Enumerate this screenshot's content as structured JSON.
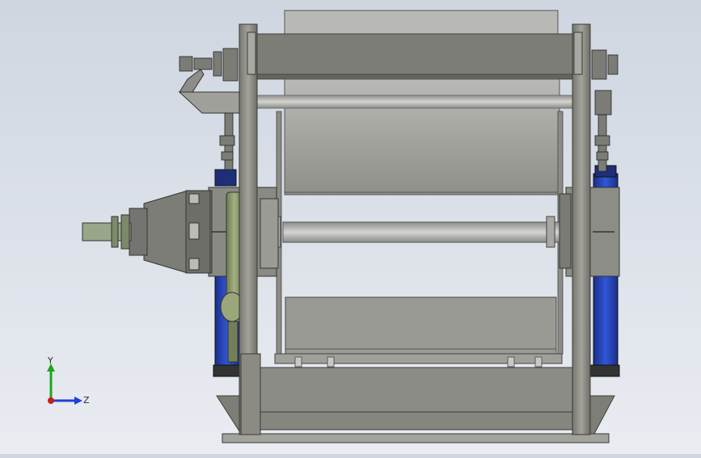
{
  "viewport": {
    "triad": {
      "y_label": "Y",
      "z_label": "Z",
      "y_color": "#1ea61e",
      "z_color": "#1f3fd6",
      "x_color": "#cc1b1b"
    },
    "colors": {
      "frame": "#8a8a84",
      "frame_dark": "#5e5e58",
      "roller": "#a9a9a3",
      "cylinder_blue": "#2744b8",
      "gear_green": "#8c9a6c"
    }
  }
}
